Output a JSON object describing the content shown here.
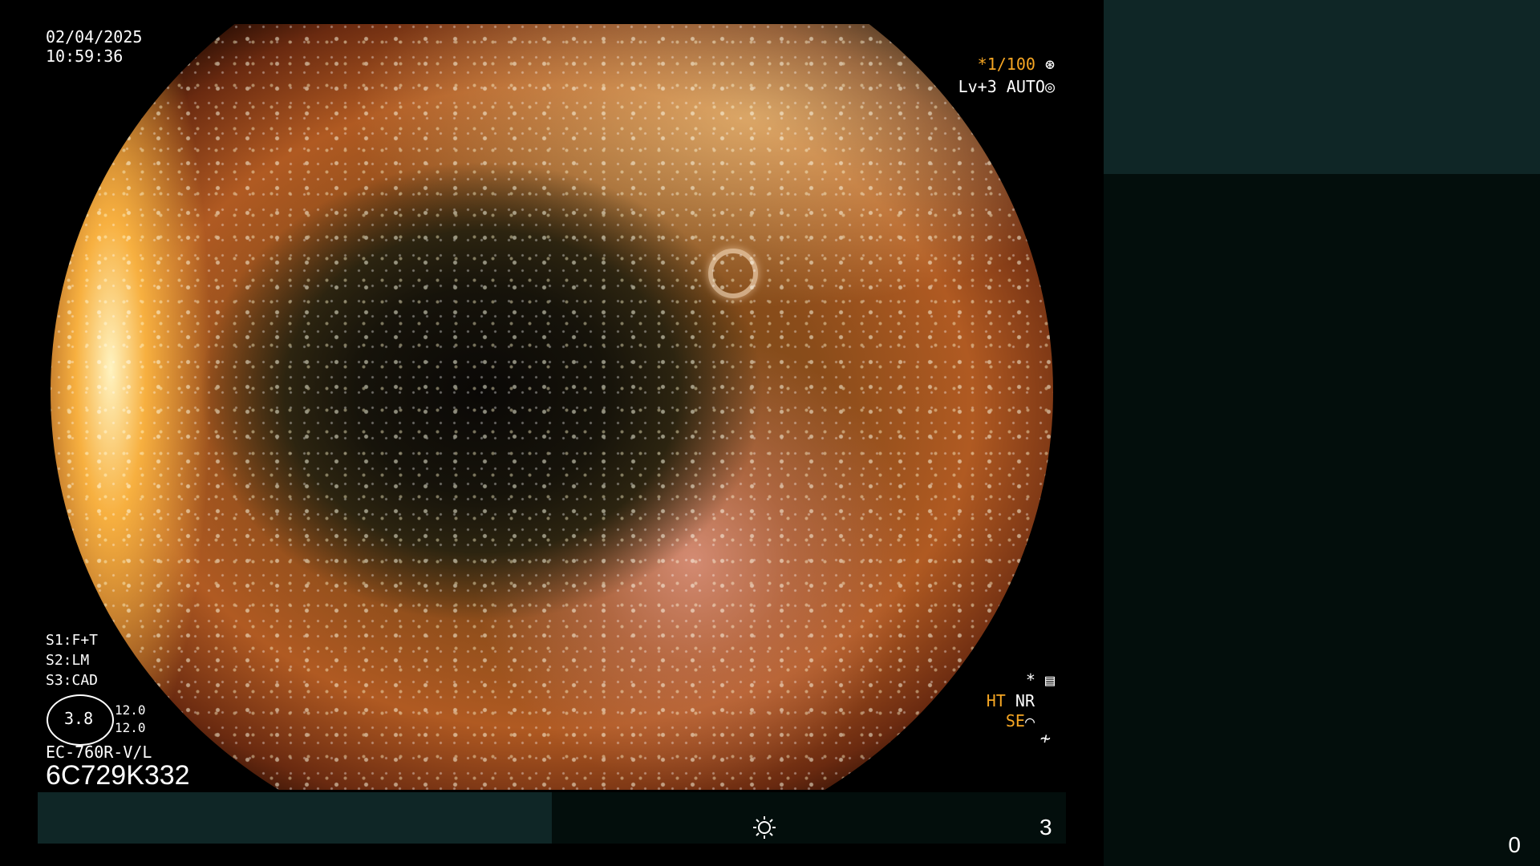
{
  "overlay": {
    "date": "02/04/2025",
    "time": "10:59:36",
    "exposure": "*1/100",
    "level": "Lv+3 AUTO",
    "s1": "S1:F+T",
    "s2": "S2:LM",
    "s3": "S3:CAD",
    "gauge_value": "3.8",
    "gauge_top": "12.0",
    "gauge_bottom": "12.0",
    "scope_model": "EC-760R-V/L",
    "serial": "6C729K332",
    "ht": "HT",
    "nr": "NR",
    "se": "SE"
  },
  "bottom_bar": {
    "number": "3"
  },
  "right_panel": {
    "counter": "0"
  },
  "colors": {
    "accent": "#f6a623",
    "panel_teal": "#0f2626",
    "panel_dark": "#030e0c"
  },
  "icons": [
    "aperture-icon",
    "settings-icon",
    "menu-icon",
    "edge-icon",
    "flash-icon",
    "brightness-icon"
  ]
}
